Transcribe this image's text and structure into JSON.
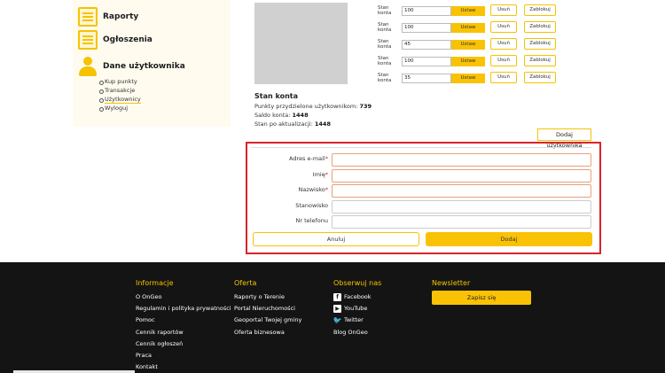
{
  "sidebar": {
    "items": [
      {
        "label": "Raporty",
        "icon": "reports-icon"
      },
      {
        "label": "Ogłoszenia",
        "icon": "announcements-icon"
      },
      {
        "label": "Dane użytkownika",
        "icon": "user-icon"
      }
    ],
    "sub_items": [
      "Kup punkty",
      "Transakcje",
      "Użytkownicy",
      "Wyloguj"
    ]
  },
  "profile": {
    "title": "Stan konta",
    "points_label": "Punkty przydzielone użytkownikom:",
    "points_value": "739",
    "balance_label": "Saldo konta:",
    "balance_value": "1448",
    "after_label": "Stan po aktualizacji:",
    "after_value": "1448"
  },
  "accounts": {
    "label": "Stan konta",
    "set_label": "Ustaw",
    "remove_label": "Usuń",
    "block_label": "Zablokuj",
    "rows": [
      {
        "value": "100"
      },
      {
        "value": "100"
      },
      {
        "value": "45"
      },
      {
        "value": "100"
      },
      {
        "value": "35"
      }
    ]
  },
  "add_user_button": "Dodaj użytkownika",
  "form": {
    "fields": [
      {
        "label": "Adres e-mail",
        "required": "*"
      },
      {
        "label": "Imię",
        "required": "*"
      },
      {
        "label": "Nazwisko",
        "required": "*"
      },
      {
        "label": "Stanowisko",
        "required": ""
      },
      {
        "label": "Nr telefonu",
        "required": ""
      }
    ],
    "cancel_label": "Anuluj",
    "submit_label": "Dodaj"
  },
  "footer": {
    "informacje": {
      "title": "Informacje",
      "links": [
        "O OnGeo",
        "Regulamin i polityka prywatności",
        "Pomoc",
        "Cennik raportów",
        "Cennik ogłoszeń",
        "Praca",
        "Kontakt"
      ]
    },
    "oferta": {
      "title": "Oferta",
      "links": [
        "Raporty o Terenie",
        "Portal Nieruchomości",
        "Geoportal Twojej gminy",
        "Oferta biznesowa"
      ]
    },
    "social": {
      "title": "Obserwuj nas",
      "links": [
        {
          "label": "Facebook",
          "icon": "facebook-icon"
        },
        {
          "label": "YouTube",
          "icon": "youtube-icon"
        },
        {
          "label": "Twitter",
          "icon": "twitter-icon"
        },
        {
          "label": "Blog OnGeo",
          "icon": ""
        }
      ]
    },
    "newsletter": {
      "title": "Newsletter",
      "button": "Zapisz się"
    }
  },
  "colors": {
    "accent": "#f9c205",
    "highlight": "#d9232a",
    "footer": "#141414"
  }
}
